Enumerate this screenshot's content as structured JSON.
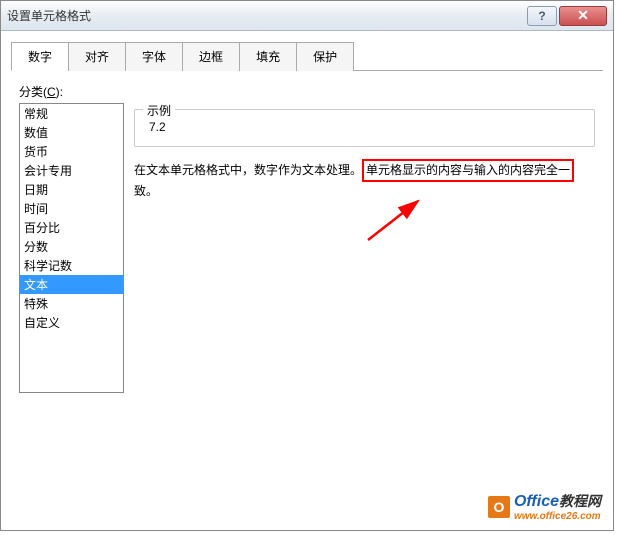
{
  "window": {
    "title": "设置单元格格式"
  },
  "titlebar": {
    "help": "?",
    "close": "✕"
  },
  "tabs": {
    "items": [
      {
        "label": "数字",
        "active": true
      },
      {
        "label": "对齐",
        "active": false
      },
      {
        "label": "字体",
        "active": false
      },
      {
        "label": "边框",
        "active": false
      },
      {
        "label": "填充",
        "active": false
      },
      {
        "label": "保护",
        "active": false
      }
    ]
  },
  "category": {
    "label_prefix": "分类(",
    "label_key": "C",
    "label_suffix": "):",
    "items": [
      "常规",
      "数值",
      "货币",
      "会计专用",
      "日期",
      "时间",
      "百分比",
      "分数",
      "科学记数",
      "文本",
      "特殊",
      "自定义"
    ],
    "selected_index": 9
  },
  "sample": {
    "legend": "示例",
    "value": "7.2"
  },
  "description": {
    "before": "在文本单元格格式中，数字作为文本处理。",
    "highlight": "单元格显示的内容与输入的内容完全一",
    "after": "致。"
  },
  "watermark": {
    "main": "Office",
    "suffix": "教程网",
    "sub": "www.office26.com"
  }
}
